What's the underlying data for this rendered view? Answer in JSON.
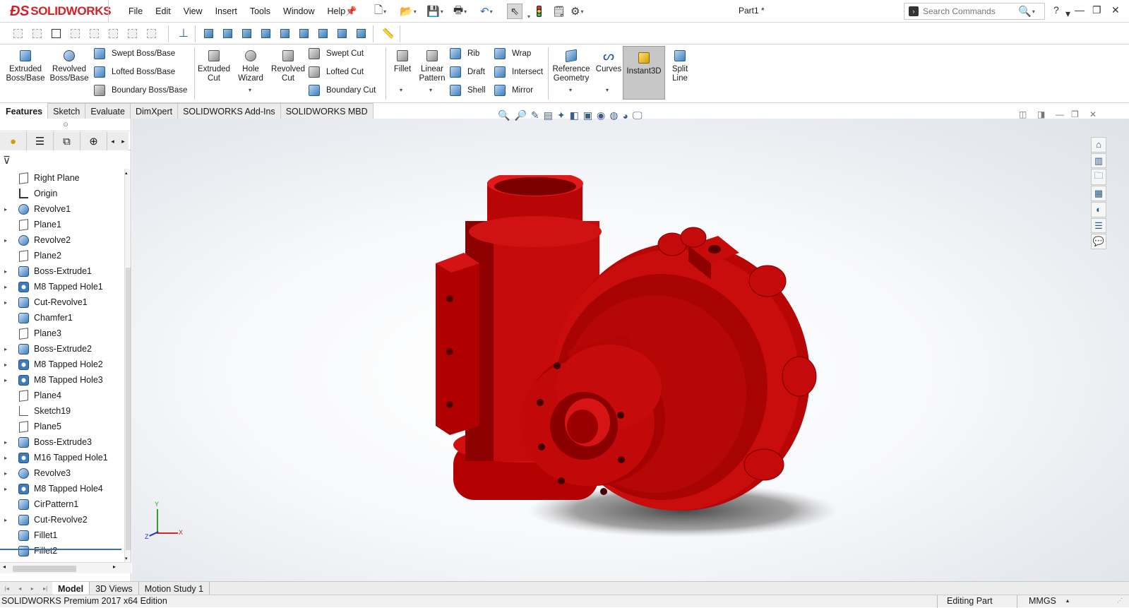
{
  "app": {
    "logo_text": "SOLIDWORKS",
    "brand_color": "#d42027",
    "document_title": "Part1 *"
  },
  "menu": [
    "File",
    "Edit",
    "View",
    "Insert",
    "Tools",
    "Window",
    "Help"
  ],
  "search": {
    "placeholder": "Search Commands"
  },
  "ribbon": {
    "extruded_boss": "Extruded Boss/Base",
    "revolved_boss": "Revolved Boss/Base",
    "swept_boss": "Swept Boss/Base",
    "lofted_boss": "Lofted Boss/Base",
    "boundary_boss": "Boundary Boss/Base",
    "extruded_cut": "Extruded Cut",
    "hole_wizard": "Hole Wizard",
    "revolved_cut": "Revolved Cut",
    "swept_cut": "Swept Cut",
    "lofted_cut": "Lofted Cut",
    "boundary_cut": "Boundary Cut",
    "fillet": "Fillet",
    "linear_pattern": "Linear Pattern",
    "rib": "Rib",
    "draft": "Draft",
    "shell": "Shell",
    "wrap": "Wrap",
    "intersect": "Intersect",
    "mirror": "Mirror",
    "reference_geometry": "Reference Geometry",
    "curves": "Curves",
    "instant3d": "Instant3D",
    "split_line": "Split Line"
  },
  "command_tabs": [
    "Features",
    "Sketch",
    "Evaluate",
    "DimXpert",
    "SOLIDWORKS Add-Ins",
    "SOLIDWORKS MBD"
  ],
  "tree": [
    {
      "label": "Right Plane",
      "icon": "plane",
      "expandable": false
    },
    {
      "label": "Origin",
      "icon": "origin",
      "expandable": false
    },
    {
      "label": "Revolve1",
      "icon": "revolve",
      "expandable": true
    },
    {
      "label": "Plane1",
      "icon": "plane",
      "expandable": false
    },
    {
      "label": "Revolve2",
      "icon": "revolve",
      "expandable": true
    },
    {
      "label": "Plane2",
      "icon": "plane",
      "expandable": false
    },
    {
      "label": "Boss-Extrude1",
      "icon": "extrude",
      "expandable": true
    },
    {
      "label": "M8 Tapped Hole1",
      "icon": "hole",
      "expandable": true
    },
    {
      "label": "Cut-Revolve1",
      "icon": "extrude",
      "expandable": true
    },
    {
      "label": "Chamfer1",
      "icon": "extrude",
      "expandable": false
    },
    {
      "label": "Plane3",
      "icon": "plane",
      "expandable": false
    },
    {
      "label": "Boss-Extrude2",
      "icon": "extrude",
      "expandable": true
    },
    {
      "label": "M8 Tapped Hole2",
      "icon": "hole",
      "expandable": true
    },
    {
      "label": "M8 Tapped Hole3",
      "icon": "hole",
      "expandable": true
    },
    {
      "label": "Plane4",
      "icon": "plane",
      "expandable": false
    },
    {
      "label": "Sketch19",
      "icon": "sketch",
      "expandable": false
    },
    {
      "label": "Plane5",
      "icon": "plane",
      "expandable": false
    },
    {
      "label": "Boss-Extrude3",
      "icon": "extrude",
      "expandable": true
    },
    {
      "label": "M16 Tapped Hole1",
      "icon": "hole",
      "expandable": true
    },
    {
      "label": "Revolve3",
      "icon": "revolve",
      "expandable": true
    },
    {
      "label": "M8 Tapped Hole4",
      "icon": "hole",
      "expandable": true
    },
    {
      "label": "CirPattern1",
      "icon": "pattern",
      "expandable": false
    },
    {
      "label": "Cut-Revolve2",
      "icon": "extrude",
      "expandable": true
    },
    {
      "label": "Fillet1",
      "icon": "extrude",
      "expandable": false
    },
    {
      "label": "Fillet2",
      "icon": "extrude",
      "expandable": false
    }
  ],
  "bottom_tabs": [
    "Model",
    "3D Views",
    "Motion Study 1"
  ],
  "status": {
    "left": "SOLIDWORKS Premium 2017 x64 Edition",
    "mode": "Editing Part",
    "units": "MMGS"
  },
  "model_color": "#c40a0a"
}
